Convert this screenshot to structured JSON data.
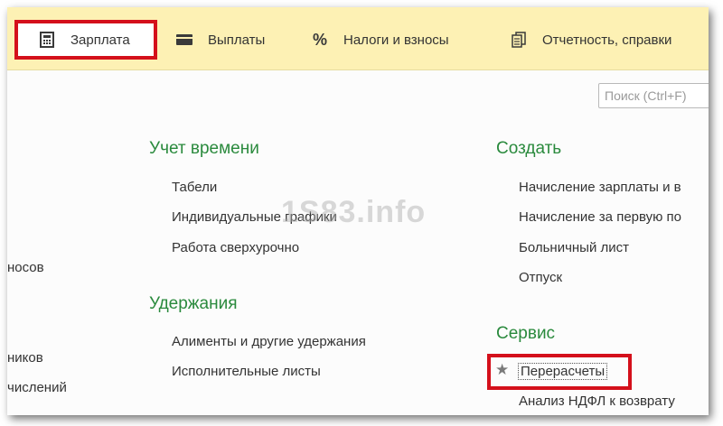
{
  "topbar": {
    "tabs": [
      {
        "label": "Зарплата",
        "icon": "calculator-icon"
      },
      {
        "label": "Выплаты",
        "icon": "wallet-icon"
      },
      {
        "label": "Налоги и взносы",
        "icon": "percent-icon"
      },
      {
        "label": "Отчетность, справки",
        "icon": "documents-icon"
      }
    ]
  },
  "search": {
    "placeholder": "Поиск (Ctrl+F)"
  },
  "left_partial": [
    "носов",
    "ников",
    "числений"
  ],
  "time_tracking": {
    "title": "Учет времени",
    "items": [
      "Табели",
      "Индивидуальные графики",
      "Работа сверхурочно"
    ]
  },
  "deductions": {
    "title": "Удержания",
    "items": [
      "Алименты и другие удержания",
      "Исполнительные листы"
    ]
  },
  "create": {
    "title": "Создать",
    "items": [
      "Начисление зарплаты и в",
      "Начисление за первую по",
      "Больничный лист",
      "Отпуск"
    ]
  },
  "service": {
    "title": "Сервис",
    "items": [
      "Перерасчеты",
      "Анализ НДФЛ к возврату"
    ]
  },
  "watermark": "1S83.info",
  "colors": {
    "accent_green": "#2a8a3d",
    "topbar_yellow": "#fdf1b4",
    "highlight_red": "#d4101b"
  }
}
